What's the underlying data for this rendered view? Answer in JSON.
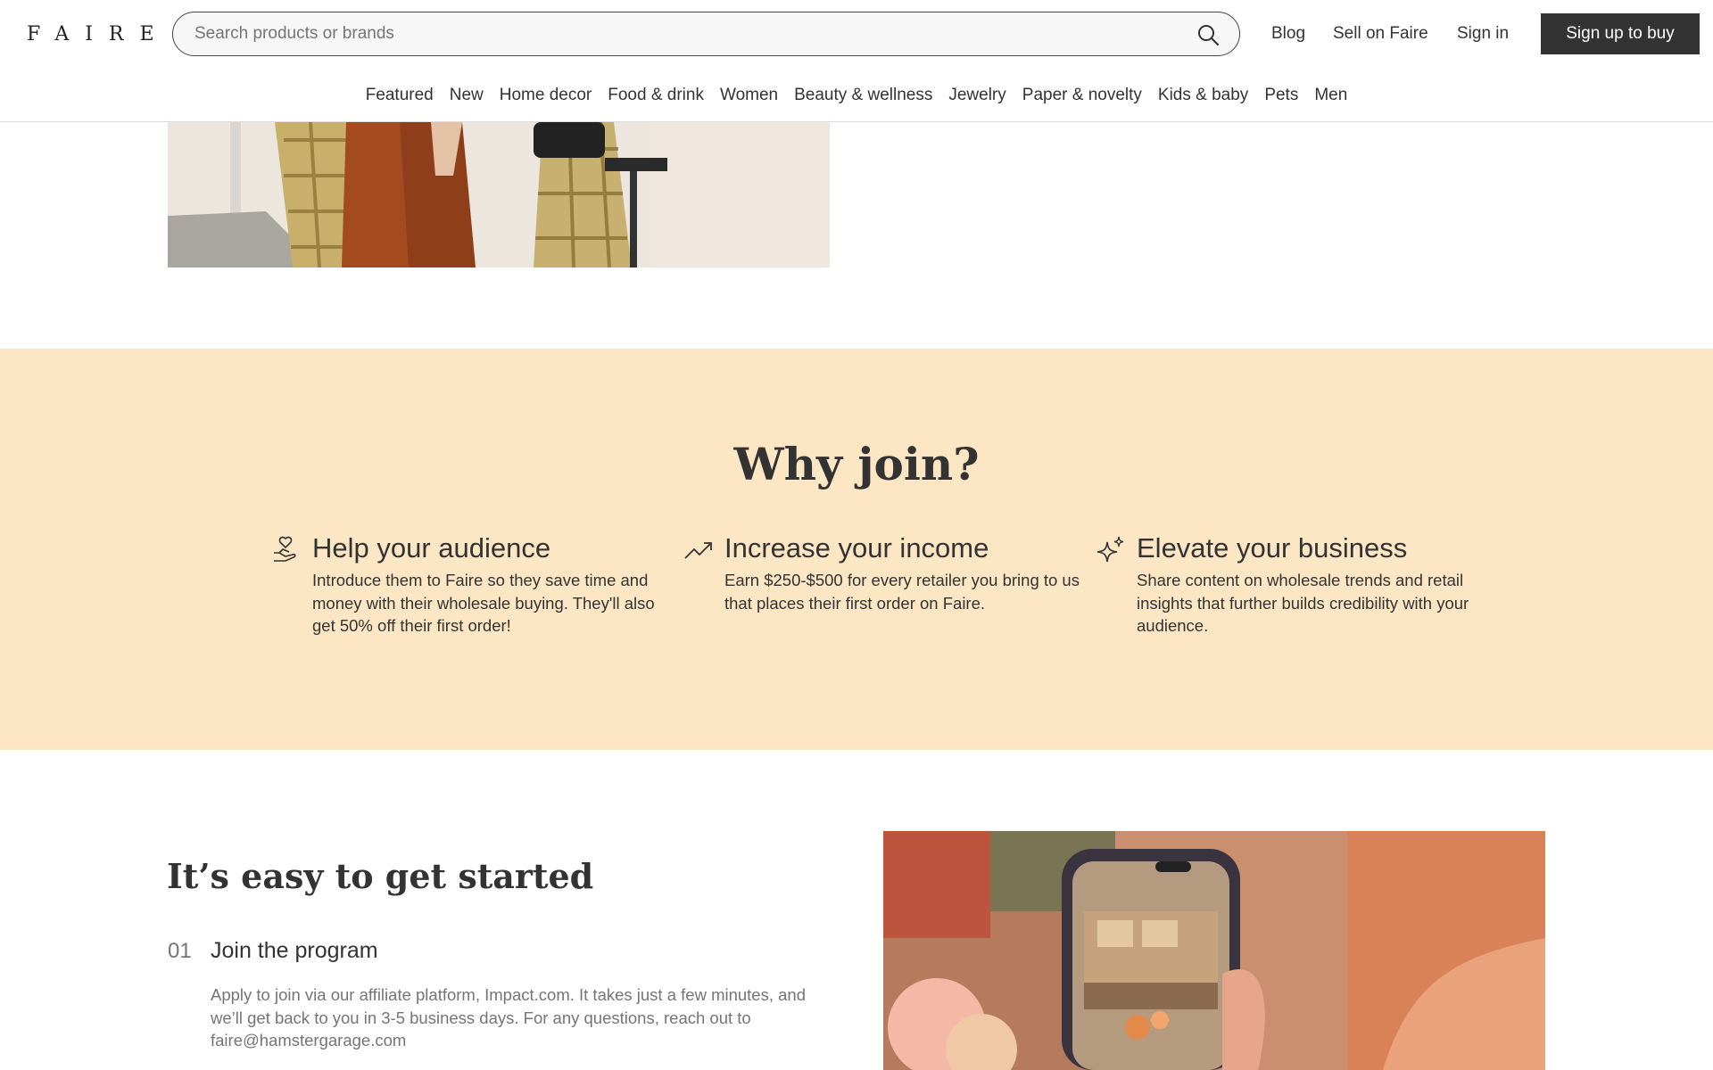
{
  "header": {
    "logo": "FAIRE",
    "search_placeholder": "Search products or brands",
    "links": {
      "blog": "Blog",
      "sell": "Sell on Faire",
      "signin": "Sign in"
    },
    "signup_label": "Sign up to buy"
  },
  "nav": [
    "Featured",
    "New",
    "Home decor",
    "Food & drink",
    "Women",
    "Beauty & wellness",
    "Jewelry",
    "Paper & novelty",
    "Kids & baby",
    "Pets",
    "Men"
  ],
  "why": {
    "title": "Why join?",
    "features": [
      {
        "icon": "hand-heart-icon",
        "title": "Help your audience",
        "text": "Introduce them to Faire so they save time and money with their wholesale buying. They'll also get 50% off their first order!"
      },
      {
        "icon": "trending-up-icon",
        "title": "Increase your income",
        "text": "Earn $250-$500 for every retailer you bring to us that places their first order on Faire."
      },
      {
        "icon": "sparkle-icon",
        "title": "Elevate your business",
        "text": "Share content on wholesale trends and retail insights that further builds credibility with your audience."
      }
    ]
  },
  "getting_started": {
    "title": "It’s easy to get started",
    "steps": [
      {
        "num": "01",
        "title": "Join the program",
        "text": "Apply to join via our affiliate platform, Impact.com. It takes just a few minutes, and we’ll get back to you in 3-5 business days. For any questions, reach out to faire@hamstergarage.com"
      }
    ]
  },
  "colors": {
    "band": "#fde6c4",
    "button": "#333333",
    "text": "#333333",
    "muted": "#757575"
  }
}
